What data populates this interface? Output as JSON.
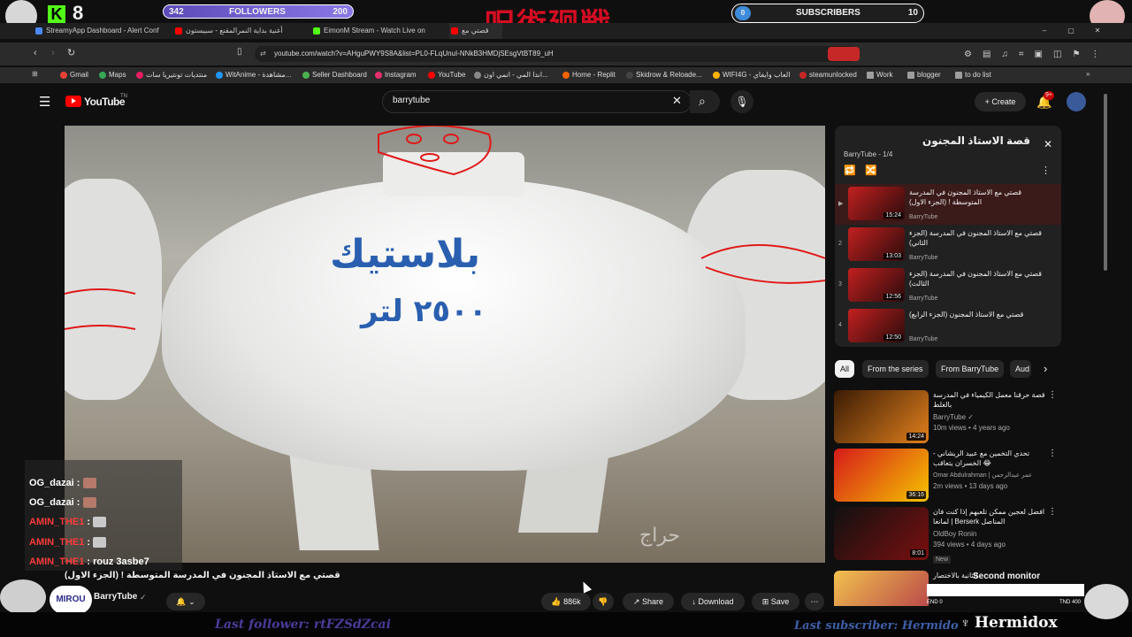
{
  "overlay": {
    "kick_count": "8",
    "followers_label": "FOLLOWERS",
    "followers_current": "342",
    "followers_goal": "200",
    "subs_label": "SUBSCRIBERS",
    "subs_current": "0",
    "subs_goal": "10",
    "title_logo": "呪術廻戦",
    "last_follower": "Last follower: rtFZSdZcai",
    "last_subscriber": "Last subscriber: Hermido",
    "streamer_handle": "Hermidox",
    "second_monitor": "Second monitor",
    "end_label": "END 0",
    "tnd_label": "TND 400",
    "chat_avatar_label": "MIROU"
  },
  "tabs": [
    {
      "label": "StreamyApp Dashboard - Alert Conf",
      "color": "#4a88ff"
    },
    {
      "label": "أغنية بداية النمرالمقنع - سبيستون",
      "color": "#ff0000"
    },
    {
      "label": "EimonM Stream - Watch Live on",
      "color": "#53fc18"
    },
    {
      "label": "قصتي مع",
      "color": "#ff0000"
    }
  ],
  "address": {
    "url": "youtube.com/watch?v=AHguPWY9S8A&list=PL0-FLqUnuI-NNkB3HMDjSEsgVtBT89_uH"
  },
  "bookmarks": [
    {
      "label": "Gmail",
      "color": "#ea4335"
    },
    {
      "label": "Maps",
      "color": "#34a853"
    },
    {
      "label": "منتديات تونتيريا سات",
      "color": "#e91e63"
    },
    {
      "label": "WitAnime - مشاهدة...",
      "color": "#2196f3"
    },
    {
      "label": "Seller Dashboard",
      "color": "#4caf50"
    },
    {
      "label": "Instagram",
      "color": "#e1306c"
    },
    {
      "label": "YouTube",
      "color": "#ff0000"
    },
    {
      "label": "اندا المي - انمي اون...",
      "color": "#888888"
    },
    {
      "label": "Home - Replit",
      "color": "#f26207"
    },
    {
      "label": "Skidrow & Reloade...",
      "color": "#444444"
    },
    {
      "label": "WIFI4G - العاب وايفاي",
      "color": "#ffb300"
    },
    {
      "label": "steamunlocked",
      "color": "#c62828"
    },
    {
      "label": "Work",
      "color": "#9e9e9e"
    },
    {
      "label": "blogger",
      "color": "#9e9e9e"
    },
    {
      "label": "to do list",
      "color": "#9e9e9e"
    }
  ],
  "youtube": {
    "logo": "YouTube",
    "logo_region": "TN",
    "search_value": "barrytube",
    "create_label": "Create",
    "notif_count": "9+"
  },
  "video": {
    "tank_text_top": "بلاستيك",
    "tank_text_bottom": "٢٥٠٠ لتر",
    "watermark": "حراج",
    "title": "قصتي مع الاستاذ المجنون في المدرسة المتوسطة ! (الجزء الاول)",
    "channel": "BarryTube",
    "likes": "886k",
    "share_label": "Share",
    "download_label": "Download",
    "save_label": "Save"
  },
  "playlist": {
    "title": "قصة الاستاذ المجنون",
    "meta": "BarryTube - 1/4",
    "items": [
      {
        "num": "▶",
        "title": "قصتي مع الاستاذ المجنون في المدرسة المتوسطة ! (الجزء الاول)",
        "channel": "BarryTube",
        "duration": "15:24"
      },
      {
        "num": "2",
        "title": "قصتي مع الاستاذ المجنون في المدرسة (الجزء الثاني)",
        "channel": "BarryTube",
        "duration": "13:03"
      },
      {
        "num": "3",
        "title": "قصتي مع الاستاذ المجنون في المدرسة (الجزء الثالث)",
        "channel": "BarryTube",
        "duration": "12:56"
      },
      {
        "num": "4",
        "title": "قصتي مع الاستاذ المجنون (الجزء الرابع)",
        "channel": "BarryTube",
        "duration": "12:50"
      }
    ]
  },
  "chips": [
    "All",
    "From the series",
    "From BarryTube",
    "Aud"
  ],
  "recommendations": [
    {
      "title": "قصة حرقنا معمل الكيمياء في المدرسة بالغلط",
      "channel": "BarryTube ✓",
      "meta": "10m views • 4 years ago",
      "duration": "14:24",
      "c1": "#3b1b05",
      "c2": "#e0801c"
    },
    {
      "title": "تحدي التخمين مع عبيد الريشاني - الخسران يتعاقب 😂",
      "channel": "Omar Abdulrahman | عمر عبدالرحمن",
      "meta": "2m views • 13 days ago",
      "duration": "36:16",
      "c1": "#d61a1a",
      "c2": "#f5c400"
    },
    {
      "title": "افضل لعجين ممكن تلعبهم إذا كنت فان لمانغا | Berserk المناصل",
      "channel": "OldBoy Ronin",
      "meta": "394 views • 4 days ago",
      "duration": "8:01",
      "badge": "New",
      "c1": "#111111",
      "c2": "#7a0f0f"
    },
    {
      "title": "الثانية بالاختصار",
      "channel": "",
      "meta": "",
      "duration": "",
      "c1": "#f2c14e",
      "c2": "#b23a48"
    }
  ],
  "chat": [
    {
      "user": "OG_dazai",
      "msg": "",
      "color": "#ffffff",
      "emote": true
    },
    {
      "user": "OG_dazai",
      "msg": "",
      "color": "#ffffff",
      "emote": true
    },
    {
      "user": "AMIN_THE1",
      "msg": "",
      "color": "#ff3b3b",
      "emote": true
    },
    {
      "user": "AMIN_THE1",
      "msg": "",
      "color": "#ff3b3b",
      "emote": true
    },
    {
      "user": "AMIN_THE1",
      "msg": "rouz 3asbe7",
      "color": "#ff3b3b",
      "emote": false
    }
  ]
}
